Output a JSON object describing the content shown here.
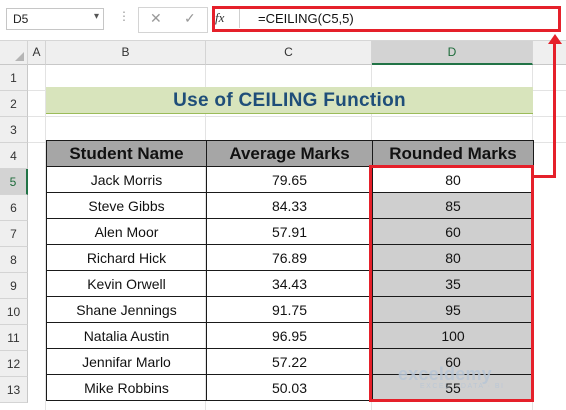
{
  "formula_bar": {
    "name_box": "D5",
    "fx_label": "fx",
    "formula": "=CEILING(C5,5)"
  },
  "columns": [
    "A",
    "B",
    "C",
    "D"
  ],
  "rows": [
    "1",
    "2",
    "3",
    "4",
    "5",
    "6",
    "7",
    "8",
    "9",
    "10",
    "11",
    "12",
    "13"
  ],
  "sheet": {
    "title": "Use of CEILING Function",
    "headers": [
      "Student Name",
      "Average Marks",
      "Rounded Marks"
    ],
    "records": [
      {
        "name": "Jack Morris",
        "avg": "79.65",
        "rounded": "80"
      },
      {
        "name": "Steve Gibbs",
        "avg": "84.33",
        "rounded": "85"
      },
      {
        "name": "Alen Moor",
        "avg": "57.91",
        "rounded": "60"
      },
      {
        "name": "Richard Hick",
        "avg": "76.89",
        "rounded": "80"
      },
      {
        "name": "Kevin Orwell",
        "avg": "34.43",
        "rounded": "35"
      },
      {
        "name": "Shane Jennings",
        "avg": "91.75",
        "rounded": "95"
      },
      {
        "name": "Natalia Austin",
        "avg": "96.95",
        "rounded": "100"
      },
      {
        "name": "Jennifar Marlo",
        "avg": "57.22",
        "rounded": "60"
      },
      {
        "name": "Mike Robbins",
        "avg": "50.03",
        "rounded": "55"
      }
    ]
  },
  "watermark": {
    "logo": "exceldemy",
    "tagline": "EXCEL · DATA · BI"
  },
  "colors": {
    "accent_red": "#e5202a",
    "title_fill": "#d8e4bc",
    "title_text": "#1f4e79",
    "header_fill": "#a6a6a6",
    "result_fill": "#cfcfcf",
    "excel_green": "#217346"
  }
}
